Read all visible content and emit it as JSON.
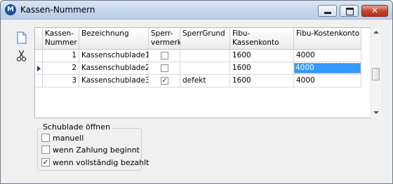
{
  "window": {
    "title": "Kassen-Nummern",
    "app_icon": "M",
    "close_glyph": "✕"
  },
  "toolbar": [
    {
      "icon": "new-document-icon"
    },
    {
      "icon": "scissors-icon"
    }
  ],
  "grid": {
    "columns": [
      {
        "key": "nr",
        "label": "Kassen-\nNummer"
      },
      {
        "key": "bez",
        "label": "Bezeichnung"
      },
      {
        "key": "sperr",
        "label": "Sperr-\nvermerk"
      },
      {
        "key": "grund",
        "label": "SperrGrund"
      },
      {
        "key": "kasse",
        "label": "Fibu-Kassenkonto"
      },
      {
        "key": "kosten",
        "label": "Fibu-Kostenkonto"
      }
    ],
    "rows": [
      {
        "nr": "1",
        "bez": "Kassenschublade1",
        "sperr": false,
        "grund": "",
        "kasse": "1600",
        "kosten": "4000"
      },
      {
        "nr": "2",
        "bez": "Kassenschublade2",
        "sperr": false,
        "grund": "",
        "kasse": "1600",
        "kosten": "4000",
        "current": true
      },
      {
        "nr": "3",
        "bez": "Kassenschublade3",
        "sperr": true,
        "grund": "defekt",
        "kasse": "1600",
        "kosten": "4000"
      }
    ],
    "check_glyph": "✓"
  },
  "schublade": {
    "title": "Schublade öffnen",
    "options": [
      {
        "label": "manuell",
        "checked": false
      },
      {
        "label": "wenn Zahlung beginnt",
        "checked": false
      },
      {
        "label": "wenn vollständig bezahlt",
        "checked": true
      }
    ]
  }
}
